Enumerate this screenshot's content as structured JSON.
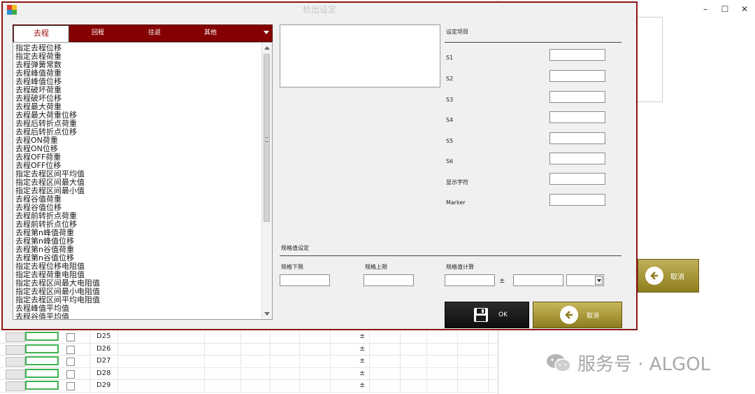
{
  "dialog": {
    "title": "检出设定"
  },
  "tabs": [
    {
      "label": "去程"
    },
    {
      "label": "回程"
    },
    {
      "label": "往返"
    },
    {
      "label": "其他"
    }
  ],
  "list_items": [
    "指定去程位移",
    "指定去程荷重",
    "去程弹簧常数",
    "去程峰值荷重",
    "去程峰值位移",
    "去程破坏荷重",
    "去程破坏位移",
    "去程最大荷重",
    "去程最大荷重位移",
    "去程后转折点荷重",
    "去程后转折点位移",
    "去程ON荷重",
    "去程ON位移",
    "去程OFF荷重",
    "去程OFF位移",
    "指定去程区间平均值",
    "指定去程区间最大值",
    "指定去程区间最小值",
    "去程谷值荷重",
    "去程谷值位移",
    "去程前转折点荷重",
    "去程前转折点位移",
    "去程第n峰值荷重",
    "去程第n峰值位移",
    "去程第n谷值荷重",
    "去程第n谷值位移",
    "指定去程位移电阻值",
    "指定去程荷重电阻值",
    "指定去程区间最大电阻值",
    "指定去程区间最小电阻值",
    "指定去程区间平均电阻值",
    "去程峰值平均值",
    "去程谷值平均值"
  ],
  "settings": {
    "header": "设定项目",
    "fields": [
      {
        "label": "S1",
        "value": ""
      },
      {
        "label": "S2",
        "value": ""
      },
      {
        "label": "S3",
        "value": ""
      },
      {
        "label": "S4",
        "value": ""
      },
      {
        "label": "S5",
        "value": ""
      },
      {
        "label": "S6",
        "value": ""
      },
      {
        "label": "显示字符",
        "value": ""
      },
      {
        "label": "Marker",
        "value": ""
      }
    ]
  },
  "spec": {
    "header": "规格值设定",
    "lower_label": "规格下限",
    "upper_label": "规格上限",
    "calc_label": "规格值计算",
    "pm": "±"
  },
  "buttons": {
    "ok": "OK",
    "cancel": "取消"
  },
  "background": {
    "cancel": "取消",
    "rows": [
      {
        "label": "D25",
        "pm": "±"
      },
      {
        "label": "D26",
        "pm": "±"
      },
      {
        "label": "D27",
        "pm": "±"
      },
      {
        "label": "D28",
        "pm": "±"
      },
      {
        "label": "D29",
        "pm": "±"
      }
    ]
  },
  "watermark": {
    "text": "服务号 · ALGOL"
  },
  "colors": {
    "accent": "#850000",
    "cancel": "#a8962e",
    "ok": "#1a1a1a",
    "row_green": "#3eb34f"
  }
}
